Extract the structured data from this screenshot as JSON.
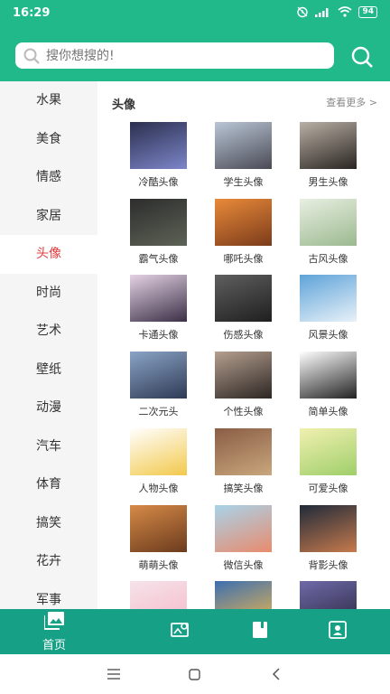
{
  "status": {
    "time": "16:29",
    "battery": "94"
  },
  "search": {
    "placeholder": "搜你想搜的!"
  },
  "sidebar": {
    "items": [
      "水果",
      "美食",
      "情感",
      "家居",
      "头像",
      "时尚",
      "艺术",
      "壁纸",
      "动漫",
      "汽车",
      "体育",
      "搞笑",
      "花卉",
      "军事"
    ],
    "active_index": 4
  },
  "section": {
    "title": "头像",
    "more": "查看更多 >"
  },
  "grid": [
    {
      "label": "冷酷头像",
      "colors": [
        "#2b2f4f",
        "#7d86c9"
      ]
    },
    {
      "label": "学生头像",
      "colors": [
        "#b9c6d6",
        "#4a4a55"
      ]
    },
    {
      "label": "男生头像",
      "colors": [
        "#b9b0a4",
        "#2a2522"
      ]
    },
    {
      "label": "霸气头像",
      "colors": [
        "#2d2d2d",
        "#5d6356"
      ]
    },
    {
      "label": "哪吒头像",
      "colors": [
        "#e98a3a",
        "#7b3b1a"
      ]
    },
    {
      "label": "古风头像",
      "colors": [
        "#e8efe2",
        "#9bb98f"
      ]
    },
    {
      "label": "卡通头像",
      "colors": [
        "#e4d2e4",
        "#3b2f46"
      ]
    },
    {
      "label": "伤感头像",
      "colors": [
        "#5f5f5f",
        "#1f1f1f"
      ]
    },
    {
      "label": "风景头像",
      "colors": [
        "#5ea3d9",
        "#e8f1f8"
      ]
    },
    {
      "label": "二次元头",
      "colors": [
        "#8aa4c6",
        "#2f3a55"
      ]
    },
    {
      "label": "个性头像",
      "colors": [
        "#b59f8f",
        "#2c2623"
      ]
    },
    {
      "label": "简单头像",
      "colors": [
        "#ffffff",
        "#222222"
      ]
    },
    {
      "label": "人物头像",
      "colors": [
        "#ffffff",
        "#f2c94c"
      ]
    },
    {
      "label": "搞笑头像",
      "colors": [
        "#8a5d45",
        "#c9a77d"
      ]
    },
    {
      "label": "可爱头像",
      "colors": [
        "#f1f0b0",
        "#9fcf6a"
      ]
    },
    {
      "label": "萌萌头像",
      "colors": [
        "#d68a47",
        "#6b3b1d"
      ]
    },
    {
      "label": "微信头像",
      "colors": [
        "#a8d3ea",
        "#e98b6d"
      ]
    },
    {
      "label": "背影头像",
      "colors": [
        "#1f2a3a",
        "#c77a4c"
      ]
    },
    {
      "label": "",
      "colors": [
        "#f6e3ea",
        "#f4b8c8"
      ]
    },
    {
      "label": "",
      "colors": [
        "#3c6fb0",
        "#f2b94b"
      ]
    },
    {
      "label": "",
      "colors": [
        "#6f6aa8",
        "#2a2740"
      ]
    }
  ],
  "tabs": [
    {
      "label": "首页",
      "icon": "gallery-icon"
    },
    {
      "label": "",
      "icon": "image-search-icon"
    },
    {
      "label": "",
      "icon": "book-icon"
    },
    {
      "label": "",
      "icon": "profile-card-icon"
    }
  ],
  "colors": {
    "header": "#22b98a",
    "tabbar": "#16a085",
    "active": "#e33b3b"
  }
}
